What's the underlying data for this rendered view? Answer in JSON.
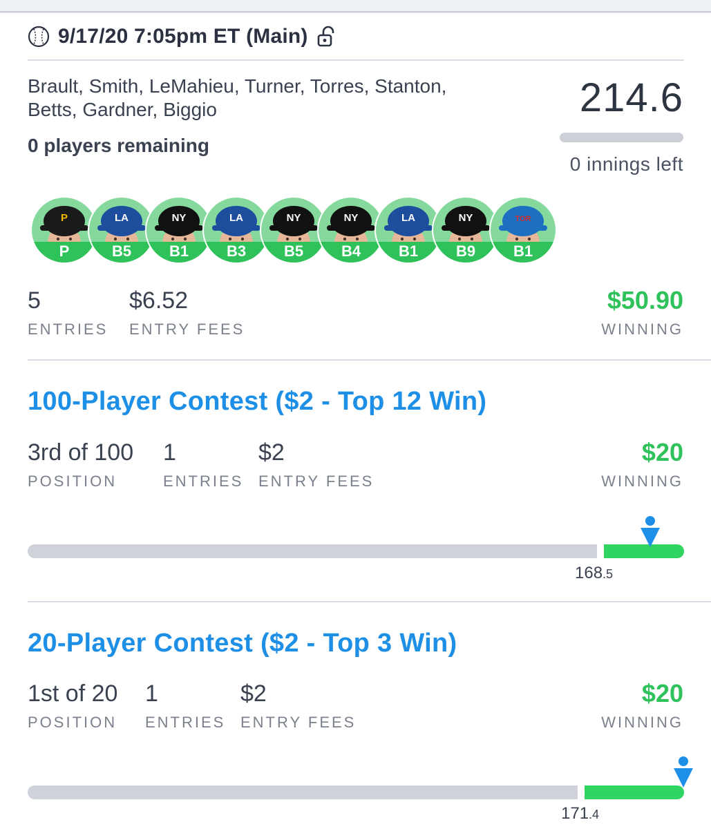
{
  "header": {
    "title": "9/17/20 7:05pm ET (Main)",
    "ball_icon": "baseball-icon",
    "lock_icon": "unlocked-lock-icon"
  },
  "lineup": {
    "names_line1": "Brault, Smith, LeMahieu, Turner, Torres, Stanton,",
    "names_line2": "Betts, Gardner, Biggio",
    "players_remaining": "0 players remaining",
    "score": "214.6",
    "innings_left": "0 innings left",
    "players": [
      {
        "pos": "P",
        "team_cap": "#1a1a1a",
        "logo_color": "#f5b800",
        "logo": "P"
      },
      {
        "pos": "B5",
        "team_cap": "#1d4e9e",
        "logo_color": "#ffffff",
        "logo": "LA"
      },
      {
        "pos": "B1",
        "team_cap": "#111111",
        "logo_color": "#ffffff",
        "logo": "NY"
      },
      {
        "pos": "B3",
        "team_cap": "#1d4e9e",
        "logo_color": "#ffffff",
        "logo": "LA"
      },
      {
        "pos": "B5",
        "team_cap": "#111111",
        "logo_color": "#ffffff",
        "logo": "NY"
      },
      {
        "pos": "B4",
        "team_cap": "#111111",
        "logo_color": "#ffffff",
        "logo": "NY"
      },
      {
        "pos": "B1",
        "team_cap": "#1d4e9e",
        "logo_color": "#ffffff",
        "logo": "LA"
      },
      {
        "pos": "B9",
        "team_cap": "#111111",
        "logo_color": "#ffffff",
        "logo": "NY"
      },
      {
        "pos": "B1",
        "team_cap": "#1d6fc2",
        "logo_color": "#d52b2b",
        "logo": "TOR"
      }
    ],
    "stats": {
      "entries_value": "5",
      "entries_label": "ENTRIES",
      "fees_value": "$6.52",
      "fees_label": "ENTRY FEES",
      "winning_value": "$50.90",
      "winning_label": "WINNING"
    }
  },
  "contests": [
    {
      "title": "100-Player Contest ($2 - Top 12 Win)",
      "position_value": "3rd of 100",
      "position_label": "POSITION",
      "entries_value": "1",
      "entries_label": "ENTRIES",
      "fees_value": "$2",
      "fees_label": "ENTRY FEES",
      "winning_value": "$20",
      "winning_label": "WINNING",
      "cutoff_whole": "168",
      "cutoff_decimal": ".5",
      "user_marker_icon": "user-pin-icon"
    },
    {
      "title": "20-Player Contest ($2 - Top 3 Win)",
      "position_value": "1st of 20",
      "position_label": "POSITION",
      "entries_value": "1",
      "entries_label": "ENTRIES",
      "fees_value": "$2",
      "fees_label": "ENTRY FEES",
      "winning_value": "$20",
      "winning_label": "WINNING",
      "cutoff_whole": "171",
      "cutoff_decimal": ".4",
      "user_marker_icon": "user-pin-icon"
    }
  ],
  "colors": {
    "accent_blue": "#1e8fe6",
    "win_green": "#2fc15a",
    "bar_green": "#2fd461",
    "bar_gray": "#cfd3d9"
  }
}
